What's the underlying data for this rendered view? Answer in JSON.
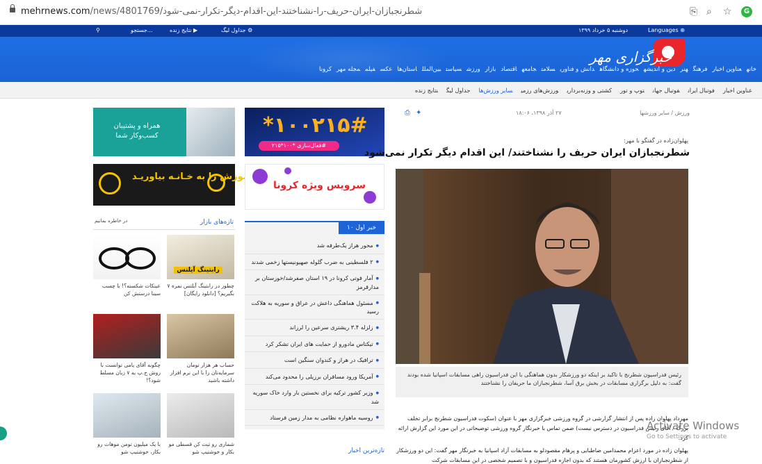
{
  "browser": {
    "url_domain": "mehrnews.com",
    "url_path": "/news/4801769/شطرنجبازان-ایران-حریف-را-نشناختند-این-اقدام-دیگر-تکرار-نمی-شود"
  },
  "topbar": {
    "search": "جستجو...",
    "live_results": "نتایج زنده",
    "league_table": "جداول لیگ",
    "date": "دوشنبه ۵ خرداد ۱۳۹۹",
    "languages": "Languages"
  },
  "logo": {
    "text": "خبرگزاری مهر"
  },
  "main_nav": [
    "خانه",
    "عناوین اخبار",
    "فرهنگ",
    "هنر",
    "دین و اندیشه",
    "حوزه و دانشگاه",
    "دانش و فناوری",
    "سلامت",
    "جامعه",
    "اقتصاد",
    "بازار",
    "ورزش",
    "سیاست",
    "بین‌الملل",
    "استان‌ها",
    "عکس",
    "فیلم",
    "مجله مهر",
    "کرونا"
  ],
  "sub_nav": [
    "عناوین اخبار",
    "فوتبال ایران",
    "فوتبال جهان",
    "توپ و تور",
    "کشتی و وزنه‌برداری",
    "ورزش‌های رزمی",
    "سایر ورزش‌ها",
    "جداول لیگ",
    "نتایج زنده"
  ],
  "sub_nav_active": "سایر ورزش‌ها",
  "ads": {
    "support": "همراه و پشتیبان کسب‌وکار شما",
    "asiatech": "با آسیاتک آموزش را به خـانـه بیاوریـد!",
    "mci_number": "*۱۰۰۲۱۵#",
    "mci_pill": "فعال‌سازی *۱۰۰*۲۱۵#",
    "corona": "سرویس ویژه کرونا"
  },
  "top_news": {
    "header": "۱۰ خبر اول",
    "items": [
      "محور هراز یک‌طرفه شد",
      "۲ فلسطینی به ضرب گلوله صهیونیستها زخمی شدند",
      "آمار فوتی کرونا در ۱۹ استان صفرشد/خوزستان بر مدارقرمز",
      "مسئول هماهنگی داعش در عراق و سوریه به هلاکت رسید",
      "زلزله ۳.۴ ریشتری سرعین را لرزاند",
      "تیکتاس مادورو از حمایت های ایران تشکر کرد",
      "ترافیک در هراز و کندوان سنگین است",
      "آمریکا ورود مسافران برزیلی را محدود می‌کند",
      "وزیر کشور ترکیه برای نخستین بار وارد خاک سوریه شد",
      "روسیه ماهواره نظامی به مدار زمین فرستاد"
    ],
    "latest": "تازه‌ترین اخبار"
  },
  "market": {
    "title": "تازه‌های بازار",
    "badge": "در خاطره بمانیم",
    "items": [
      "چطور در رابتینگ آیلتس نمره ۷ بگیریم؟ [دانلود رایگان]",
      "عینکات شکسته؟! با چسب سینا درستش کن",
      "حساب هر هزار تومان سرمایه‌تان را با این نرم افزار داشته باشید",
      "چگونه آقای یامی توانست با روش ج.پ به ۷ زبان مسلط شود؟!",
      "شماری رو ثبت کن قسطی مو بکار و خوشتیپ شو",
      "با یک میلیون تومن موهات رو بکار، خوشتیپ شو"
    ],
    "ielts_label": "رابتینگ آیلتس"
  },
  "article": {
    "breadcrumb": "ورزش / سایر ورزشها",
    "date": "۲۷ آذر ۱۳۹۸، ۱۸:۰۶",
    "lead": "پهلوان‌زاده در گفتگو با مهر:",
    "title": "شطرنجبازان ایران حریف را نشناختند/ این اقدام دیگر تکرار نمی‌شود",
    "caption": "رئیس فدراسیون شطرنج با تاکید بر اینکه دو ورزشکار بدون هماهنگی با این فدراسیون راهی مسابقات اسپانیا شده بودند گفت: به دلیل برگزاری مسابقات در بخش برق آسا، شطرنجبازان ما حریفان را نشناختند",
    "body1": "مهرداد پهلوان زاده پس از انتشار گزارشی در گروه ورزشی خبرگزاری مهر با عنوان (سکوت فدراسیون شطرنج برابر تخلف بزرگ / آقای رئیس فدراسیون در دسترس نیست) ضمن تماس با خبرنگار گروه ورزشی توضیحاتی در این مورد این گزارش ارائه کرد.",
    "body2": "پهلوان زاده در مورد اعزام محمدامین ضاطبایی و پرهام مقصودلو به مسابقات آزاد اسپانیا به خبرنگار مهر گفت: این دو ورزشکار از شطرنجبازان با ارزش کشورمان هستند که بدون اجازه فدراسیون و با تصمیم شخصی در این مسابقات شرکت"
  },
  "watermark": {
    "line1": "Activate Windows",
    "line2": "Go to Settings to activate"
  }
}
